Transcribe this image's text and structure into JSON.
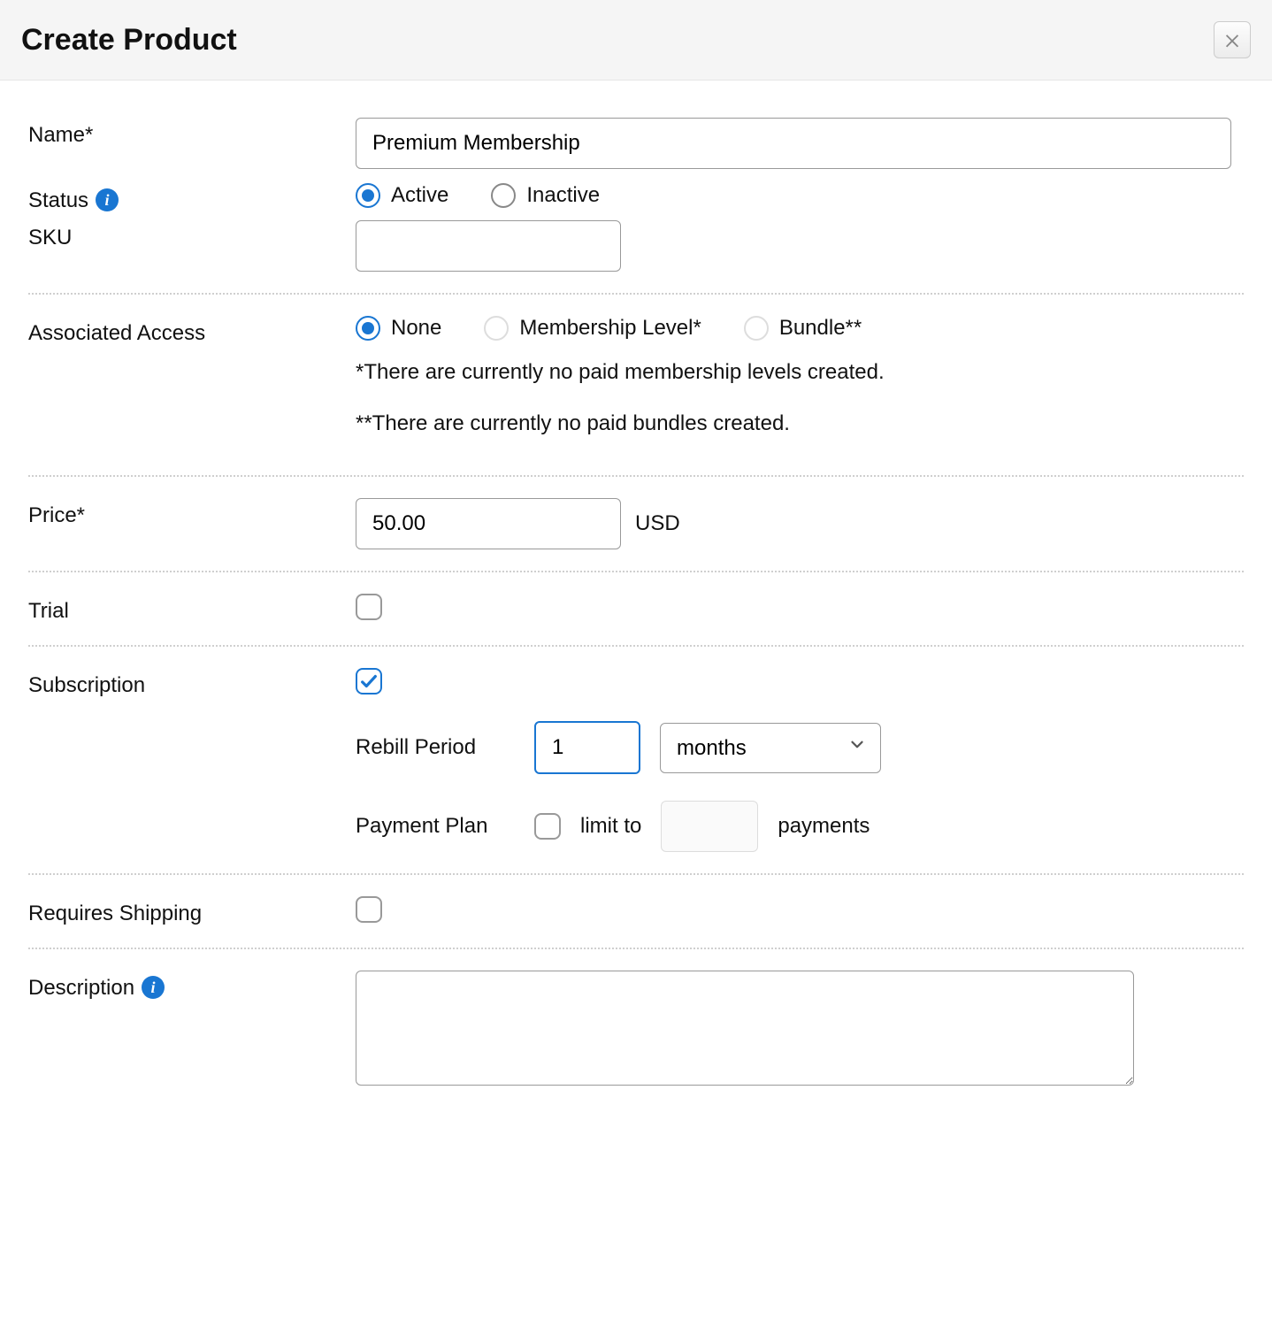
{
  "header": {
    "title": "Create Product"
  },
  "labels": {
    "name": "Name*",
    "status": "Status",
    "sku": "SKU",
    "assoc": "Associated Access",
    "price": "Price*",
    "trial": "Trial",
    "subscription": "Subscription",
    "rebill": "Rebill Period",
    "payment_plan": "Payment Plan",
    "limit_to": "limit to",
    "payments": "payments",
    "shipping": "Requires Shipping",
    "description": "Description",
    "currency": "USD"
  },
  "values": {
    "name": "Premium Membership",
    "sku": "",
    "price": "50.00",
    "rebill_count": "1",
    "rebill_unit": "months",
    "payment_limit": "",
    "description": ""
  },
  "status_options": {
    "active": "Active",
    "inactive": "Inactive"
  },
  "access_options": {
    "none": "None",
    "membership": "Membership Level*",
    "bundle": "Bundle**"
  },
  "notes": {
    "membership": "*There are currently no paid membership levels created.",
    "bundle": "**There are currently no paid bundles created."
  }
}
